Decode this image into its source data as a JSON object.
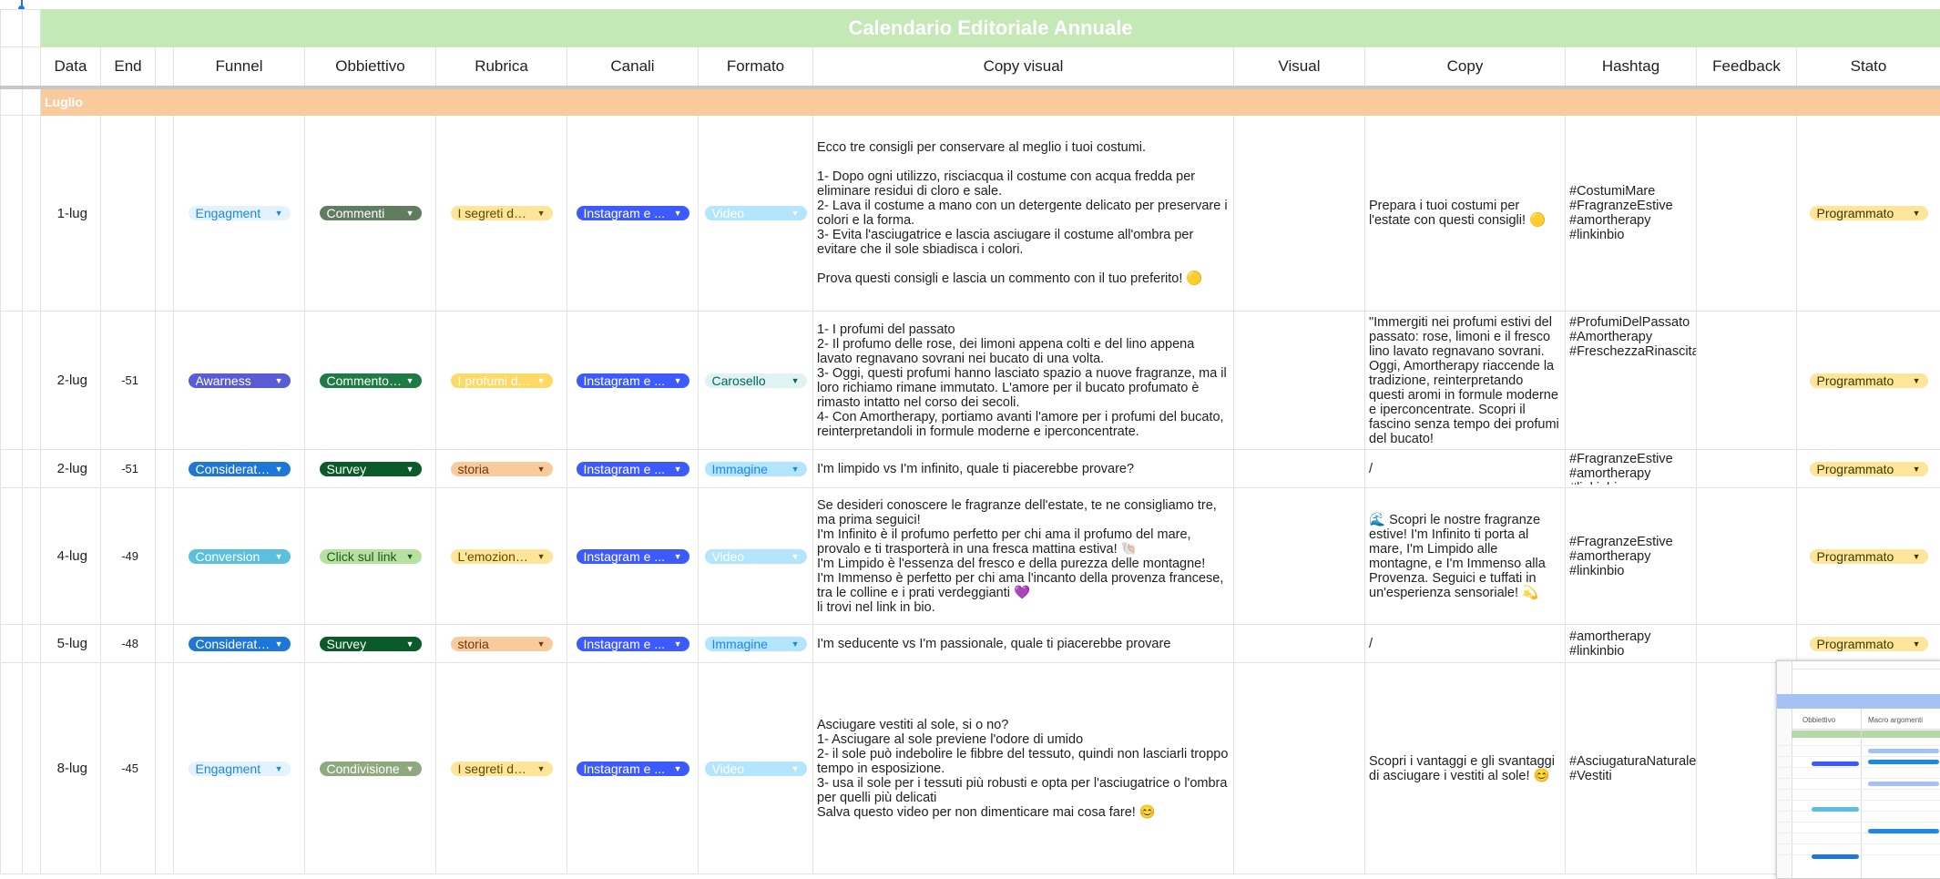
{
  "title": "Calendario Editoriale Annuale",
  "headers": [
    "Data",
    "End",
    "Funnel",
    "Obbiettivo",
    "Rubrica",
    "Canali",
    "Formato",
    "Copy visual",
    "Visual",
    "Copy",
    "Hashtag",
    "Feedback",
    "Stato"
  ],
  "month": "Luglio",
  "colors": {
    "title_bg": "#c5e8b7",
    "month_bg": "#f9cb9c",
    "engagement_bg": "#e3f2fd",
    "engagement_fg": "#1e88e5",
    "awareness_bg": "#5b5bd6",
    "consideration_bg": "#1e77d6",
    "conversion_bg": "#5bc0de",
    "stato_bg": "#ffe599"
  },
  "rows": [
    {
      "date": "1-lug",
      "end": "",
      "funnel": "Engagment",
      "obiettivo": "Commenti",
      "rubrica": "I segreti del b...",
      "canali": "Instagram e ...",
      "formato": "Video",
      "copy_visual": "Ecco tre consigli per conservare al meglio i tuoi costumi.\n\n1- Dopo ogni utilizzo, risciacqua il costume con acqua fredda per eliminare residui di cloro e sale.\n2- Lava il costume a mano con un detergente delicato per preservare i colori e la forma.\n3- Evita l'asciugatrice e lascia asciugare il costume all'ombra per evitare che il sole sbiadisca i colori.\n\nProva questi consigli e lascia un commento con il tuo preferito! 🟡",
      "copy": "Prepara i tuoi costumi per l'estate con questi consigli! 🟡",
      "hashtag": "#CostumiMare\n#FragranzeEstive\n#amortherapy\n#linkinbio",
      "stato": "Programmato"
    },
    {
      "date": "2-lug",
      "end": "-51",
      "funnel": "Awarness",
      "obiettivo": "Commento e...",
      "rubrica": "I profumi del ...",
      "canali": "Instagram e ...",
      "formato": "Carosello",
      "copy_visual": "1- I profumi del passato\n2- Il profumo delle rose, dei limoni appena colti e del lino appena lavato regnavano sovrani nei bucato di una volta.\n3- Oggi, questi profumi hanno lasciato spazio a nuove fragranze, ma il loro richiamo rimane immutato. L'amore per il bucato profumato è rimasto intatto nel corso dei secoli.\n4- Con Amortherapy, portiamo avanti l'amore per i profumi del bucato, reinterpretandoli in formule moderne e iperconcentrate.",
      "copy": "\"Immergiti nei profumi estivi del passato: rose, limoni e il fresco lino lavato regnavano sovrani. Oggi, Amortherapy riaccende la tradizione, reinterpretando questi aromi in formule moderne e iperconcentrate. Scopri il fascino senza tempo dei profumi del bucato!",
      "hashtag": "#ProfumiDelPassato\n#Amortherapy\n#FreschezzaRinascita\"",
      "stato": "Programmato"
    },
    {
      "date": "2-lug",
      "end": "-51",
      "funnel": "Consideration",
      "obiettivo": "Survey",
      "rubrica": "storia",
      "canali": "Instagram e ...",
      "formato": "Immagine",
      "copy_visual": "I'm limpido vs I'm infinito, quale ti piacerebbe provare?",
      "copy": "/",
      "hashtag": "#FragranzeEstive\n#amortherapy\n#linkinbio",
      "stato": "Programmato"
    },
    {
      "date": "4-lug",
      "end": "-49",
      "funnel": "Conversion",
      "obiettivo": "Click sul link",
      "rubrica": "L'emozione d...",
      "canali": "Instagram e ...",
      "formato": "Video",
      "copy_visual": "Se desideri conoscere le fragranze dell'estate, te ne consigliamo tre, ma prima seguici!\nI'm Infinito è il profumo perfetto per chi ama il profumo del mare, provalo e ti trasporterà in una fresca mattina estiva! 🐚\nI'm Limpido è l'essenza del fresco e della purezza delle montagne!\nI'm Immenso è perfetto per chi ama l'incanto della provenza francese, tra le colline e i prati verdeggianti 💜\nli trovi nel link in bio.",
      "copy": "🌊 Scopri le nostre fragranze estive! I'm Infinito ti porta al mare, I'm Limpido alle montagne, e I'm Immenso alla Provenza. Seguici e tuffati in un'esperienza sensoriale! 💫",
      "hashtag": "#FragranzeEstive\n#amortherapy\n#linkinbio",
      "stato": "Programmato"
    },
    {
      "date": "5-lug",
      "end": "-48",
      "funnel": "Consideration",
      "obiettivo": "Survey",
      "rubrica": "storia",
      "canali": "Instagram e ...",
      "formato": "Immagine",
      "copy_visual": " I'm seducente vs I'm passionale, quale ti piacerebbe provare",
      "copy": "/",
      "hashtag": "#amortherapy\n#linkinbio",
      "stato": "Programmato"
    },
    {
      "date": "8-lug",
      "end": "-45",
      "funnel": "Engagment",
      "obiettivo": "Condivisione",
      "rubrica": "I segreti del b...",
      "canali": "Instagram e ...",
      "formato": "Video",
      "copy_visual": "Asciugare vestiti al sole, si o no?\n1- Asciugare al sole previene l'odore di umido\n2- il sole può indebolire le fibbre del tessuto, quindi non lasciarli troppo tempo in esposizione.\n3- usa il sole per i tessuti più robusti e opta per l'asciugatrice o l'ombra per quelli più delicati\nSalva questo video per non dimenticare mai cosa fare! 😊",
      "copy": "Scopri i vantaggi e gli svantaggi di asciugare i vestiti al sole! 😊",
      "hashtag": "#AsciugaturaNaturale #Vestiti",
      "stato": "Programmato"
    }
  ],
  "mini": {
    "col1": "Obbiettivo",
    "col2": "Macro argomenti"
  }
}
